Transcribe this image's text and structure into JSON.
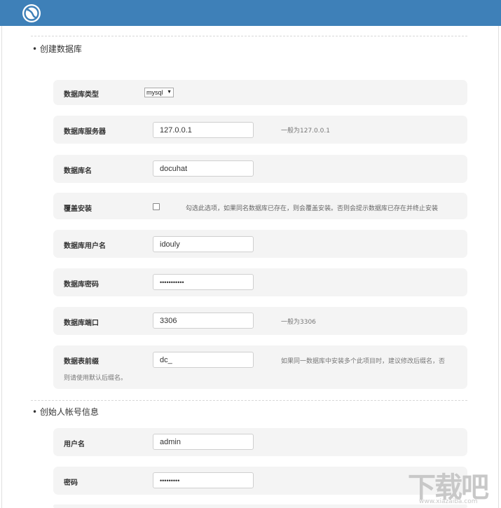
{
  "header": {
    "logo_icon": "bird-logo-icon",
    "bg_color": "#3e80b8"
  },
  "section1": {
    "title": "• 创建数据库",
    "rows": {
      "db_type": {
        "label": "数据库类型",
        "value": "mysql"
      },
      "db_server": {
        "label": "数据库服务器",
        "value": "127.0.0.1",
        "hint": "一般为127.0.0.1"
      },
      "db_name": {
        "label": "数据库名",
        "value": "docuhat"
      },
      "overwrite": {
        "label": "覆盖安装",
        "hint": "勾选此选项，如果同名数据库已存在，则会覆盖安装。否则会提示数据库已存在并终止安装"
      },
      "db_user": {
        "label": "数据库用户名",
        "value": "idouly"
      },
      "db_password": {
        "label": "数据库密码",
        "value": "•••••••••••"
      },
      "db_port": {
        "label": "数据库端口",
        "value": "3306",
        "hint": "一般为3306"
      },
      "db_prefix": {
        "label": "数据表前缀",
        "value": "dc_",
        "hint_line1": "如果同一数据库中安装多个此项目时，建议修改后缀名，否",
        "hint_line2": "则请使用默认后缀名。"
      }
    }
  },
  "section2": {
    "title": "• 创始人帐号信息",
    "rows": {
      "username": {
        "label": "用户名",
        "value": "admin"
      },
      "password": {
        "label": "密码",
        "value": "•••••••••"
      }
    }
  },
  "watermark": {
    "text": "下载吧",
    "url": "www.xiazaiba.com"
  }
}
